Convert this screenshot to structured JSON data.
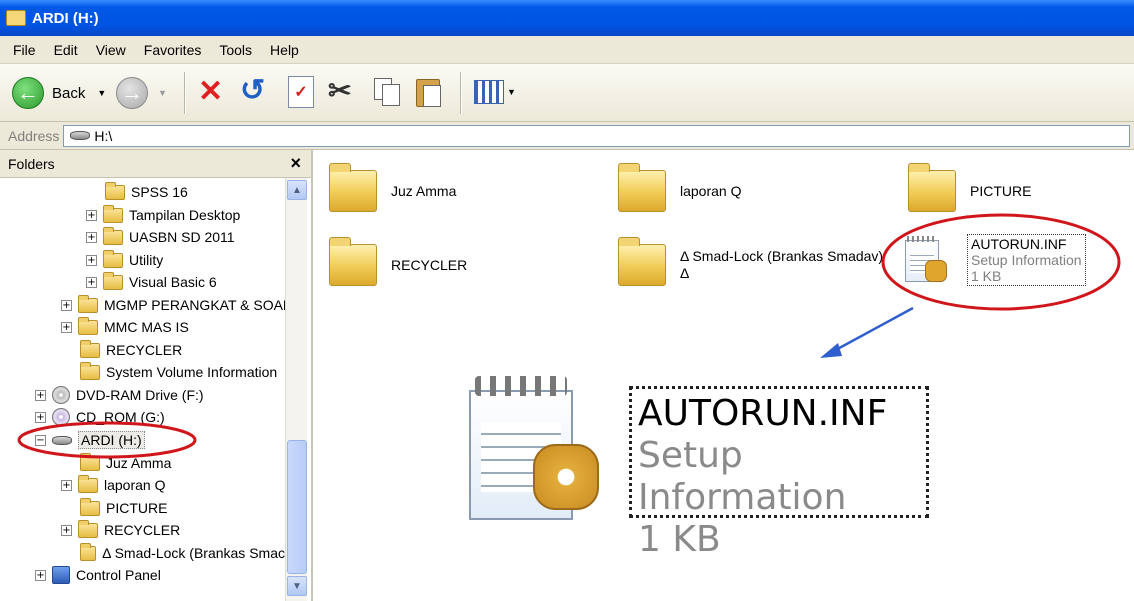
{
  "window": {
    "title": "ARDI (H:)"
  },
  "menu": [
    "File",
    "Edit",
    "View",
    "Favorites",
    "Tools",
    "Help"
  ],
  "toolbar": {
    "back_label": "Back"
  },
  "address": {
    "label": "Address",
    "value": "H:\\"
  },
  "folders_pane": {
    "title": "Folders",
    "close": "×",
    "items": [
      {
        "label": "SPSS 16",
        "icon": "folder-icon"
      },
      {
        "label": "Tampilan Desktop",
        "icon": "folder-icon"
      },
      {
        "label": "UASBN SD 2011",
        "icon": "folder-icon"
      },
      {
        "label": "Utility",
        "icon": "folder-icon"
      },
      {
        "label": "Visual Basic 6",
        "icon": "folder-icon"
      },
      {
        "label": "MGMP PERANGKAT & SOAL",
        "icon": "folder-icon"
      },
      {
        "label": "MMC MAS IS",
        "icon": "folder-icon"
      },
      {
        "label": "RECYCLER",
        "icon": "folder-icon"
      },
      {
        "label": "System Volume Information",
        "icon": "folder-icon"
      },
      {
        "label": "DVD-RAM Drive (F:)",
        "icon": "dvd-drive-icon"
      },
      {
        "label": "CD_ROM (G:)",
        "icon": "cd-drive-icon"
      },
      {
        "label": "ARDI (H:)",
        "icon": "removable-drive-icon"
      },
      {
        "label": "Juz Amma",
        "icon": "folder-icon"
      },
      {
        "label": "laporan Q",
        "icon": "folder-icon"
      },
      {
        "label": "PICTURE",
        "icon": "folder-icon"
      },
      {
        "label": "RECYCLER",
        "icon": "folder-icon"
      },
      {
        "label": "Δ Smad-Lock (Brankas Smac",
        "icon": "folder-icon"
      },
      {
        "label": "Control Panel",
        "icon": "control-panel-icon"
      }
    ]
  },
  "content": {
    "items": [
      {
        "label": "Juz Amma"
      },
      {
        "label": "laporan Q"
      },
      {
        "label": "PICTURE"
      },
      {
        "label": "RECYCLER"
      },
      {
        "label": "Δ Smad-Lock (Brankas Smadav)",
        "label2": "Δ"
      }
    ],
    "autorun": {
      "name": "AUTORUN.INF",
      "type": "Setup Information",
      "size": "1 KB"
    }
  },
  "colors": {
    "titlebar": "#0054e3",
    "annotation": "#d0161a",
    "arrow": "#2f5fcf"
  }
}
